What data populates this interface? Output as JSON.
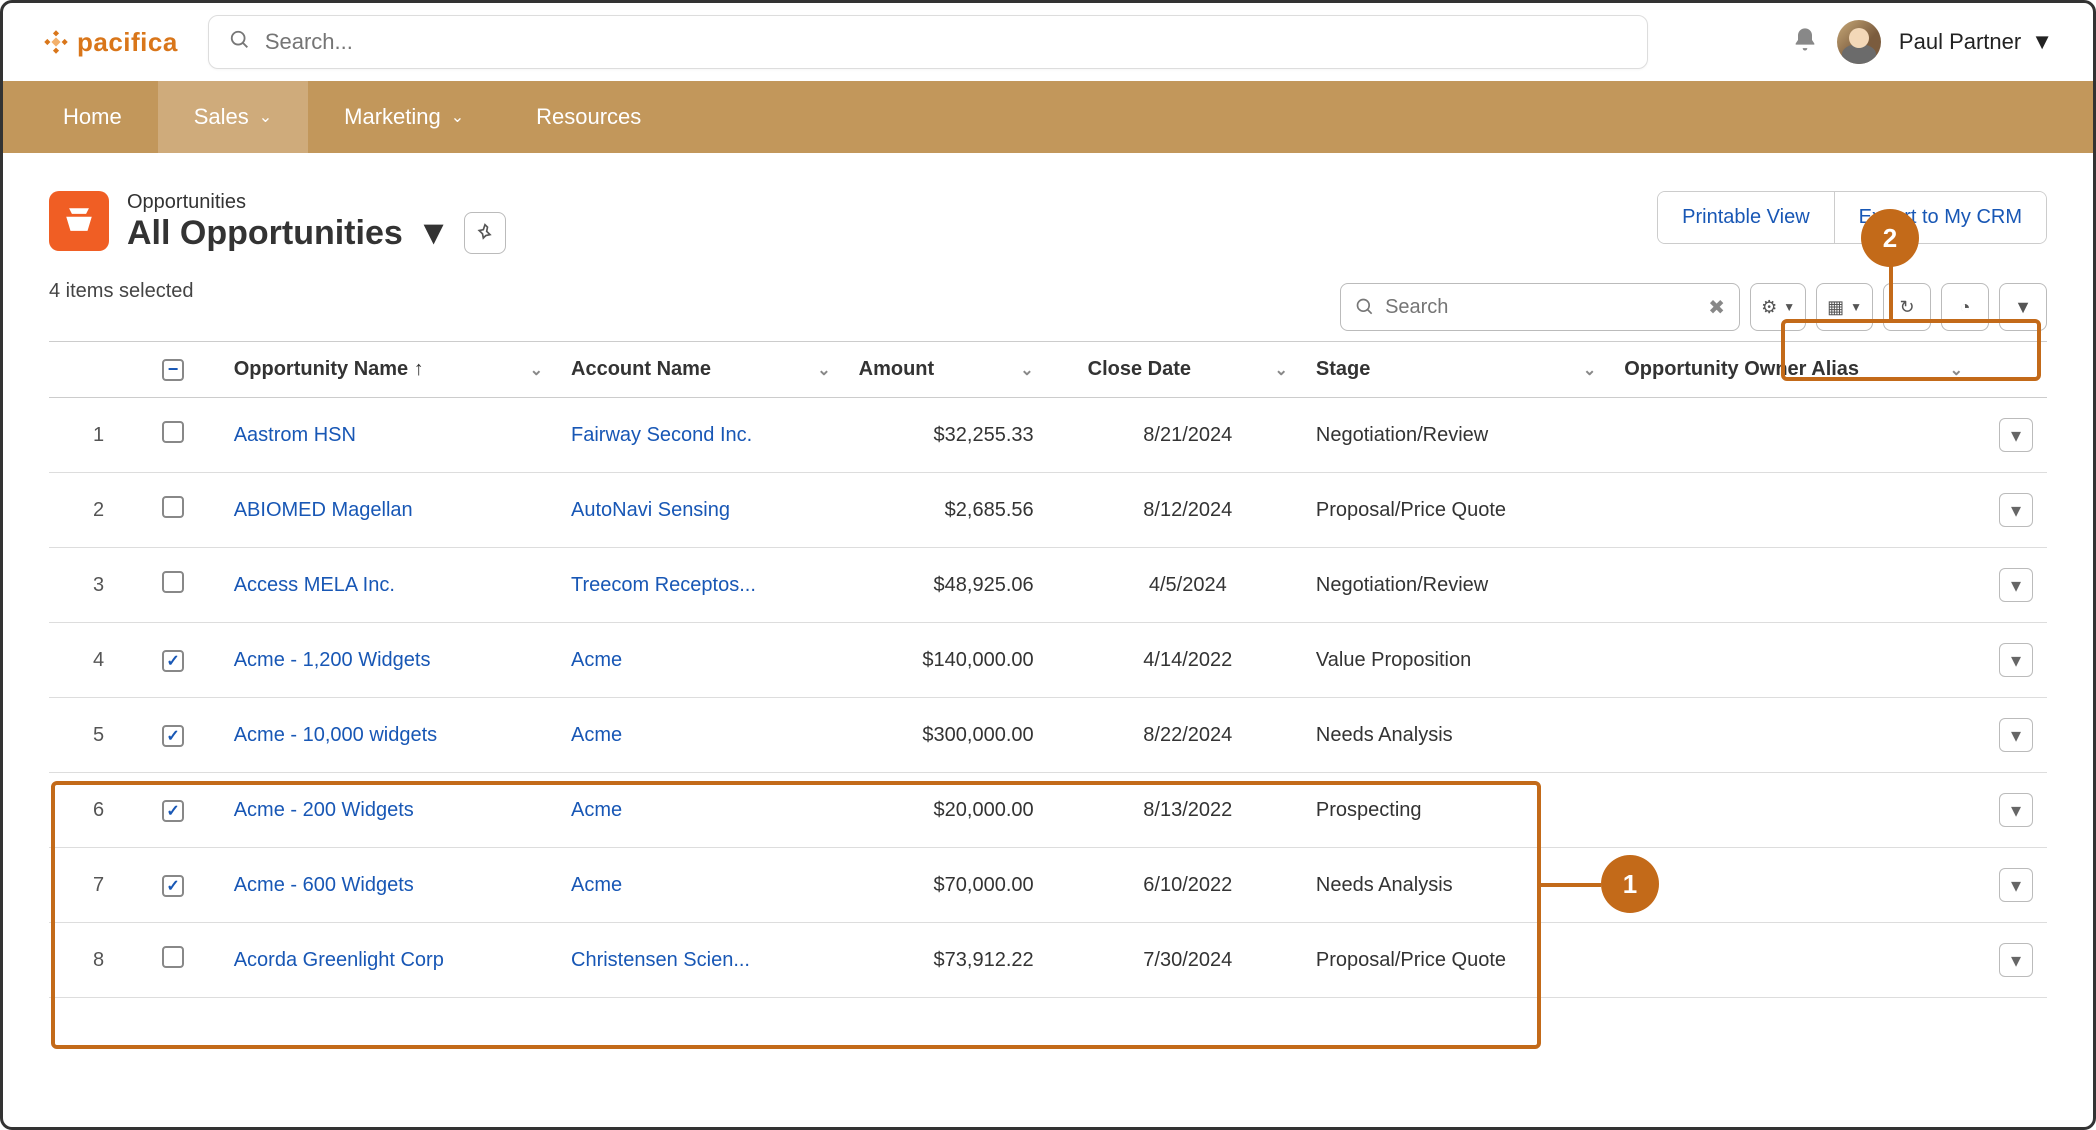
{
  "brand": {
    "name": "pacifica"
  },
  "search": {
    "placeholder": "Search..."
  },
  "user": {
    "name": "Paul Partner"
  },
  "nav": {
    "items": [
      {
        "label": "Home",
        "dropdown": false
      },
      {
        "label": "Sales",
        "dropdown": true
      },
      {
        "label": "Marketing",
        "dropdown": true
      },
      {
        "label": "Resources",
        "dropdown": false
      }
    ]
  },
  "page": {
    "kicker": "Opportunities",
    "title": "All Opportunities",
    "selected_text": "4 items selected"
  },
  "actions": {
    "printable": "Printable View",
    "export": "Export to My CRM"
  },
  "list_search": {
    "placeholder": "Search"
  },
  "columns": {
    "name": "Opportunity Name",
    "account": "Account Name",
    "amount": "Amount",
    "close": "Close Date",
    "stage": "Stage",
    "owner": "Opportunity Owner Alias"
  },
  "rows": [
    {
      "n": "1",
      "checked": false,
      "name": "Aastrom HSN",
      "account": "Fairway Second Inc.",
      "amount": "$32,255.33",
      "close": "8/21/2024",
      "stage": "Negotiation/Review"
    },
    {
      "n": "2",
      "checked": false,
      "name": "ABIOMED Magellan",
      "account": "AutoNavi Sensing",
      "amount": "$2,685.56",
      "close": "8/12/2024",
      "stage": "Proposal/Price Quote"
    },
    {
      "n": "3",
      "checked": false,
      "name": "Access MELA Inc.",
      "account": "Treecom Receptos...",
      "amount": "$48,925.06",
      "close": "4/5/2024",
      "stage": "Negotiation/Review"
    },
    {
      "n": "4",
      "checked": true,
      "name": "Acme - 1,200 Widgets",
      "account": "Acme",
      "amount": "$140,000.00",
      "close": "4/14/2022",
      "stage": "Value Proposition"
    },
    {
      "n": "5",
      "checked": true,
      "name": "Acme - 10,000 widgets",
      "account": "Acme",
      "amount": "$300,000.00",
      "close": "8/22/2024",
      "stage": "Needs Analysis"
    },
    {
      "n": "6",
      "checked": true,
      "name": "Acme - 200 Widgets",
      "account": "Acme",
      "amount": "$20,000.00",
      "close": "8/13/2022",
      "stage": "Prospecting"
    },
    {
      "n": "7",
      "checked": true,
      "name": "Acme - 600 Widgets",
      "account": "Acme",
      "amount": "$70,000.00",
      "close": "6/10/2022",
      "stage": "Needs Analysis"
    },
    {
      "n": "8",
      "checked": false,
      "name": "Acorda Greenlight Corp",
      "account": "Christensen Scien...",
      "amount": "$73,912.22",
      "close": "7/30/2024",
      "stage": "Proposal/Price Quote"
    }
  ],
  "callouts": {
    "one": "1",
    "two": "2"
  }
}
